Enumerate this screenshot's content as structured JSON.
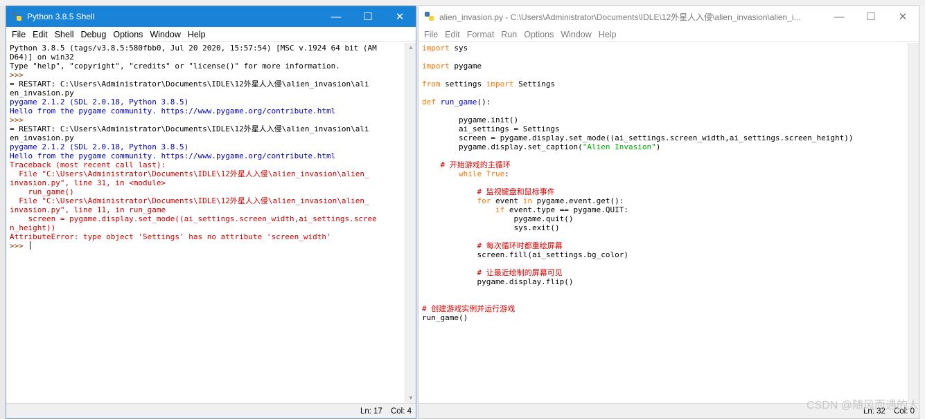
{
  "shell": {
    "title": "Python 3.8.5 Shell",
    "menu": [
      "File",
      "Edit",
      "Shell",
      "Debug",
      "Options",
      "Window",
      "Help"
    ],
    "lines": [
      {
        "t": "Python 3.8.5 (tags/v3.8.5:580fbb0, Jul 20 2020, 15:57:54) [MSC v.1924 64 bit (AM",
        "c": "out"
      },
      {
        "t": "D64)] on win32",
        "c": "out"
      },
      {
        "t": "Type \"help\", \"copyright\", \"credits\" or \"license()\" for more information.",
        "c": "out"
      },
      {
        "t": ">>> ",
        "c": "prompt"
      },
      {
        "t": "= RESTART: C:\\Users\\Administrator\\Documents\\IDLE\\12外星人入侵\\alien_invasion\\ali",
        "c": "out"
      },
      {
        "t": "en_invasion.py",
        "c": "out"
      },
      {
        "t": "pygame 2.1.2 (SDL 2.0.18, Python 3.8.5)",
        "c": "blue"
      },
      {
        "t": "Hello from the pygame community. https://www.pygame.org/contribute.html",
        "c": "blue"
      },
      {
        "t": ">>> ",
        "c": "prompt"
      },
      {
        "t": "= RESTART: C:\\Users\\Administrator\\Documents\\IDLE\\12外星人入侵\\alien_invasion\\ali",
        "c": "out"
      },
      {
        "t": "en_invasion.py",
        "c": "out"
      },
      {
        "t": "pygame 2.1.2 (SDL 2.0.18, Python 3.8.5)",
        "c": "blue"
      },
      {
        "t": "Hello from the pygame community. https://www.pygame.org/contribute.html",
        "c": "blue"
      },
      {
        "t": "Traceback (most recent call last):",
        "c": "err"
      },
      {
        "t": "  File \"C:\\Users\\Administrator\\Documents\\IDLE\\12外星人入侵\\alien_invasion\\alien_",
        "c": "err"
      },
      {
        "t": "invasion.py\", line 31, in <module>",
        "c": "err"
      },
      {
        "t": "    run_game()",
        "c": "err"
      },
      {
        "t": "  File \"C:\\Users\\Administrator\\Documents\\IDLE\\12外星人入侵\\alien_invasion\\alien_",
        "c": "err"
      },
      {
        "t": "invasion.py\", line 11, in run_game",
        "c": "err"
      },
      {
        "t": "    screen = pygame.display.set_mode((ai_settings.screen_width,ai_settings.scree",
        "c": "err"
      },
      {
        "t": "n_height))",
        "c": "err"
      },
      {
        "t": "AttributeError: type object 'Settings' has no attribute 'screen_width'",
        "c": "err"
      },
      {
        "t": ">>> ",
        "c": "prompt"
      }
    ],
    "status_ln": "Ln: 17",
    "status_col": "Col: 4"
  },
  "editor": {
    "title": "alien_invasion.py - C:\\Users\\Administrator\\Documents\\IDLE\\12外星人入侵\\alien_invasion\\alien_i...",
    "menu": [
      "File",
      "Edit",
      "Format",
      "Run",
      "Options",
      "Window",
      "Help"
    ],
    "code": [
      [
        [
          "kw",
          "import"
        ],
        [
          "n",
          " sys"
        ]
      ],
      [],
      [
        [
          "kw",
          "import"
        ],
        [
          "n",
          " pygame"
        ]
      ],
      [],
      [
        [
          "kw",
          "from"
        ],
        [
          "n",
          " settings "
        ],
        [
          "kw",
          "import"
        ],
        [
          "n",
          " Settings"
        ]
      ],
      [],
      [
        [
          "kw",
          "def"
        ],
        [
          "n",
          " "
        ],
        [
          "fn",
          "run_game"
        ],
        [
          "n",
          "():"
        ]
      ],
      [],
      [
        [
          "n",
          "        pygame.init()"
        ]
      ],
      [
        [
          "n",
          "        ai_settings = Settings"
        ]
      ],
      [
        [
          "n",
          "        screen = pygame.display.set_mode((ai_settings.screen_width,ai_settings.screen_height))"
        ]
      ],
      [
        [
          "n",
          "        pygame.display.set_caption("
        ],
        [
          "str",
          "\"Alien Invasion\""
        ],
        [
          "n",
          ")"
        ]
      ],
      [],
      [
        [
          "cmt",
          "    # 开始游戏的主循环"
        ]
      ],
      [
        [
          "n",
          "        "
        ],
        [
          "kw",
          "while"
        ],
        [
          "n",
          " "
        ],
        [
          "kw",
          "True"
        ],
        [
          "n",
          ":"
        ]
      ],
      [],
      [
        [
          "cmt",
          "            # 监视键盘和鼠标事件"
        ]
      ],
      [
        [
          "n",
          "            "
        ],
        [
          "kw",
          "for"
        ],
        [
          "n",
          " event "
        ],
        [
          "kw",
          "in"
        ],
        [
          "n",
          " pygame.event.get():"
        ]
      ],
      [
        [
          "n",
          "                "
        ],
        [
          "kw",
          "if"
        ],
        [
          "n",
          " event.type == pygame.QUIT:"
        ]
      ],
      [
        [
          "n",
          "                    pygame.quit()"
        ]
      ],
      [
        [
          "n",
          "                    sys.exit()"
        ]
      ],
      [],
      [
        [
          "cmt",
          "            # 每次循环时都重绘屏幕"
        ]
      ],
      [
        [
          "n",
          "            screen.fill(ai_settings.bg_color)"
        ]
      ],
      [],
      [
        [
          "cmt",
          "            # 让最近绘制的屏幕可见"
        ]
      ],
      [
        [
          "n",
          "            pygame.display.flip()"
        ]
      ],
      [],
      [],
      [
        [
          "cmt",
          "# 创建游戏实例并运行游戏"
        ]
      ],
      [
        [
          "n",
          "run_game()"
        ]
      ]
    ],
    "status_ln": "Ln: 32",
    "status_col": "Col: 0"
  },
  "watermark": "CSDN @随风而遇的人",
  "colors": {
    "shell_titlebar": "#1883d7",
    "keyword": "#ff7700",
    "comment": "#dd0000",
    "string": "#00aa00",
    "output_blue": "#0000c0"
  }
}
